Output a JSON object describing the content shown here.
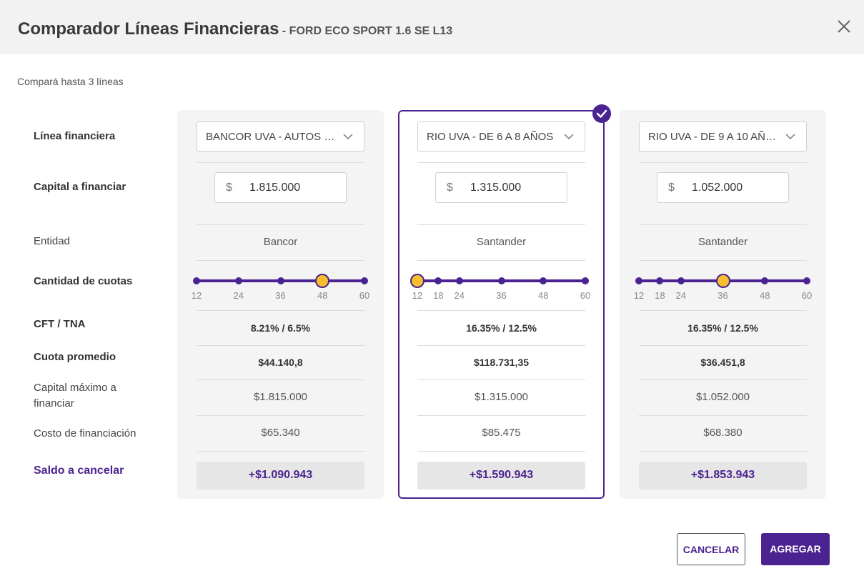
{
  "dialog": {
    "title": "Comparador Líneas Financieras",
    "subtitle": "- FORD ECO SPORT 1.6 SE L13",
    "hint": "Compará hasta 3 líneas"
  },
  "row_labels": {
    "linea": "Línea financiera",
    "capital": "Capital a financiar",
    "entidad": "Entidad",
    "cuotas": "Cantidad de cuotas",
    "cft": "CFT / TNA",
    "cuota_promedio": "Cuota promedio",
    "capital_maximo": "Capital máximo a financiar",
    "costo": "Costo de financiación",
    "saldo": "Saldo a cancelar"
  },
  "columns": [
    {
      "linea": "BANCOR UVA - AUTOS H...",
      "currency": "$",
      "capital": "1.815.000",
      "entidad": "Bancor",
      "cuotas_options": [
        "12",
        "24",
        "36",
        "48",
        "60"
      ],
      "cuotas_selected": "48",
      "cft_tna": "8.21% / 6.5%",
      "cuota_promedio": "$44.140,8",
      "capital_maximo": "$1.815.000",
      "costo": "$65.340",
      "saldo": "+$1.090.943",
      "selected": false
    },
    {
      "linea": "RIO UVA - DE 6 A 8 AÑOS",
      "currency": "$",
      "capital": "1.315.000",
      "entidad": "Santander",
      "cuotas_options": [
        "12",
        "18",
        "24",
        "36",
        "48",
        "60"
      ],
      "cuotas_selected": "12",
      "cft_tna": "16.35% / 12.5%",
      "cuota_promedio": "$118.731,35",
      "capital_maximo": "$1.315.000",
      "costo": "$85.475",
      "saldo": "+$1.590.943",
      "selected": true
    },
    {
      "linea": "RIO UVA - DE 9 A 10 AÑOS",
      "currency": "$",
      "capital": "1.052.000",
      "entidad": "Santander",
      "cuotas_options": [
        "12",
        "18",
        "24",
        "36",
        "48",
        "60"
      ],
      "cuotas_selected": "36",
      "cft_tna": "16.35% / 12.5%",
      "cuota_promedio": "$36.451,8",
      "capital_maximo": "$1.052.000",
      "costo": "$68.380",
      "saldo": "+$1.853.943",
      "selected": false
    }
  ],
  "footer": {
    "cancel_label": "CANCELAR",
    "add_label": "AGREGAR"
  },
  "colors": {
    "accent": "#4b2391",
    "thumb": "#f7bf2e"
  },
  "icons": {
    "close": "close-icon",
    "dropdown": "chevron-down-icon",
    "selected": "check-circle-icon"
  }
}
